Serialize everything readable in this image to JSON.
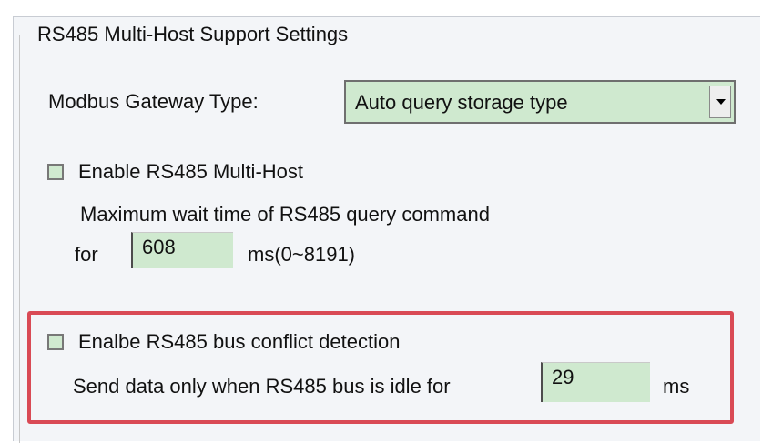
{
  "group_title": "RS485 Multi-Host Support Settings",
  "modbus": {
    "label": "Modbus Gateway Type:",
    "selected": "Auto query storage type"
  },
  "multihost": {
    "checkbox_label": "Enable RS485 Multi-Host",
    "checked": false,
    "wait_text": "Maximum wait time of RS485  query command",
    "for_label": "for",
    "wait_value": "608",
    "range_label": "ms(0~8191)"
  },
  "conflict": {
    "checkbox_label": "Enalbe RS485 bus conflict detection",
    "checked": false,
    "idle_text": "Send data only when RS485 bus is idle for",
    "idle_value": "29",
    "unit_label": "ms"
  },
  "colors": {
    "field_bg": "#cfe9cf",
    "highlight": "#d94a55",
    "panel_bg": "#f3f5f8"
  }
}
